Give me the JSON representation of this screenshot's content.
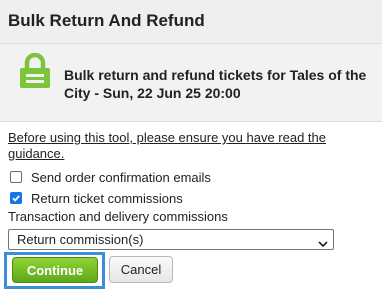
{
  "dialog": {
    "title": "Bulk Return And Refund"
  },
  "header": {
    "icon": "lock-icon",
    "icon_color": "#7cc43a",
    "headline": "Bulk return and refund tickets for Tales of the City - Sun, 22 Jun 25 20:00"
  },
  "guidance": {
    "link_text": "Before using this tool, please ensure you have read the guidance."
  },
  "options": {
    "send_confirmation": {
      "label": "Send order confirmation emails",
      "checked": false
    },
    "return_commissions": {
      "label": "Return ticket commissions",
      "checked": true
    }
  },
  "transaction": {
    "label": "Transaction and delivery commissions",
    "selected": "Return commission(s)"
  },
  "buttons": {
    "continue_label": "Continue",
    "cancel_label": "Cancel",
    "continue_color": "#6fbf26"
  }
}
